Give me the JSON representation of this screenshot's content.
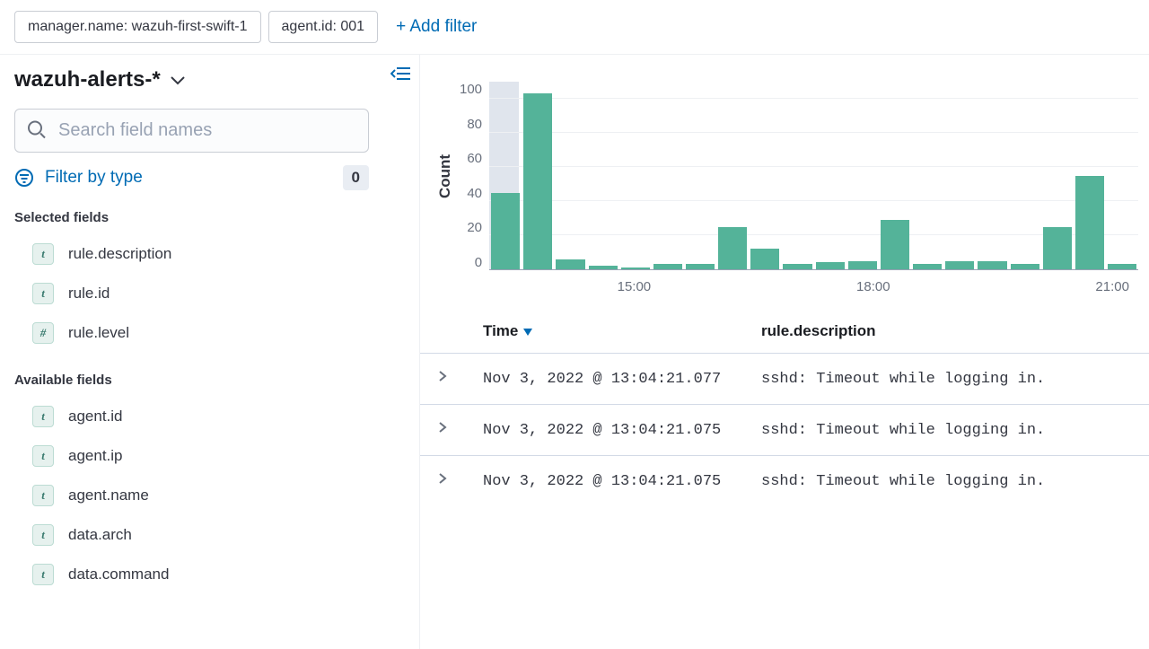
{
  "filters": [
    "manager.name: wazuh-first-swift-1",
    "agent.id: 001"
  ],
  "add_filter_label": "+ Add filter",
  "index_pattern": "wazuh-alerts-*",
  "search_placeholder": "Search field names",
  "filter_by_type_label": "Filter by type",
  "filter_by_type_count": "0",
  "selected_fields_title": "Selected fields",
  "available_fields_title": "Available fields",
  "selected_fields": [
    {
      "type": "t",
      "name": "rule.description"
    },
    {
      "type": "t",
      "name": "rule.id"
    },
    {
      "type": "#",
      "name": "rule.level"
    }
  ],
  "available_fields": [
    {
      "type": "t",
      "name": "agent.id"
    },
    {
      "type": "t",
      "name": "agent.ip"
    },
    {
      "type": "t",
      "name": "agent.name"
    },
    {
      "type": "t",
      "name": "data.arch"
    },
    {
      "type": "t",
      "name": "data.command"
    }
  ],
  "table": {
    "columns": {
      "time": "Time",
      "desc": "rule.description"
    },
    "rows": [
      {
        "time": "Nov 3, 2022 @ 13:04:21.077",
        "desc": "sshd: Timeout while logging in."
      },
      {
        "time": "Nov 3, 2022 @ 13:04:21.075",
        "desc": "sshd: Timeout while logging in."
      },
      {
        "time": "Nov 3, 2022 @ 13:04:21.075",
        "desc": "sshd: Timeout while logging in."
      }
    ]
  },
  "chart_data": {
    "type": "bar",
    "ylabel": "Count",
    "ylim": [
      0,
      110
    ],
    "y_ticks": [
      0,
      20,
      40,
      60,
      80,
      100
    ],
    "x_ticks": [
      "15:00",
      "18:00",
      "21:00"
    ],
    "x_tick_positions_pct": [
      22,
      59,
      96
    ],
    "selection_band_pct": [
      0,
      4.5
    ],
    "values": [
      45,
      103,
      6,
      2,
      1,
      3,
      3,
      25,
      12,
      3,
      4,
      5,
      29,
      3,
      5,
      5,
      3,
      25,
      55,
      3
    ]
  }
}
